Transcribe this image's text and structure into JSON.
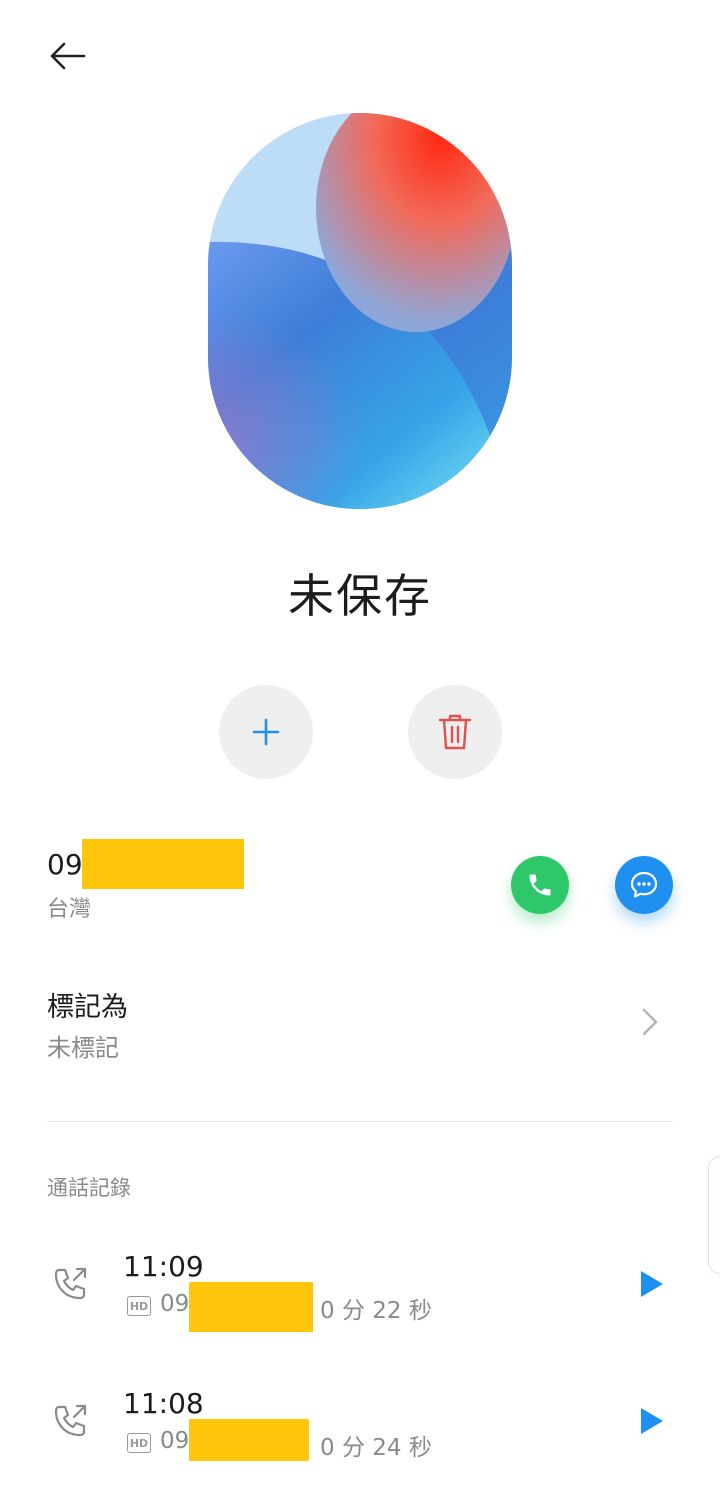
{
  "header": {
    "back_icon": "arrow-left-icon"
  },
  "contact": {
    "name": "未保存",
    "actions": {
      "add_icon": "plus-icon",
      "delete_icon": "trash-icon"
    }
  },
  "phone": {
    "number_prefix": "09",
    "region": "台灣",
    "call_icon": "phone-icon",
    "message_icon": "message-icon"
  },
  "mark": {
    "title": "標記為",
    "value": "未標記"
  },
  "call_log": {
    "label": "通話記錄",
    "entries": [
      {
        "time": "11:09",
        "number_prefix": "09",
        "duration": "0 分 22 秒",
        "badge": "HD"
      },
      {
        "time": "11:08",
        "number_prefix": "09",
        "duration": "0 分 24 秒",
        "badge": "HD"
      }
    ]
  },
  "colors": {
    "accent_blue": "#1f8ff0",
    "call_green": "#2ec76a",
    "delete_red": "#e0504f",
    "redaction": "#ffc60b"
  }
}
